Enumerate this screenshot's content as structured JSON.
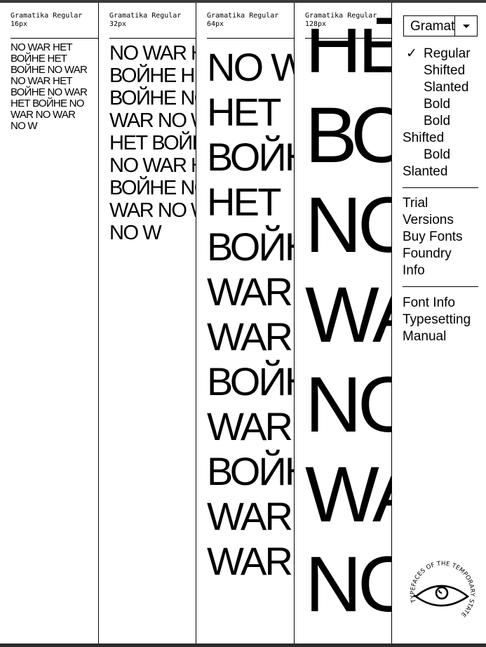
{
  "columns": [
    {
      "id": "c16",
      "header": "Gramatika Regular",
      "size": "16px",
      "lines": [
        "NO WAR НЕТ",
        "ВОЙНЕ НЕТ",
        "ВОЙНЕ NO WAR",
        "NO WAR НЕТ",
        "ВОЙНЕ NO WAR",
        "НЕТ ВОЙНЕ NO",
        "WAR NO WAR",
        "NO W"
      ]
    },
    {
      "id": "c32",
      "header": "Gramatika Regular",
      "size": "32px",
      "lines": [
        "NO WAR НЕТ",
        "ВОЙНЕ НЕТ",
        "ВОЙНЕ NO",
        "WAR NO WAR",
        "НЕТ ВОЙНЕ",
        "NO WAR НЕТ",
        "ВОЙНЕ NO",
        "WAR NO WAR",
        "NO W"
      ]
    },
    {
      "id": "c64",
      "header": "Gramatika Regular",
      "size": "64px",
      "lines": [
        "NO WAR",
        "НЕТ",
        "ВОЙНЕ",
        "НЕТ",
        "ВОЙНЕ",
        "WAR",
        "WAR",
        "ВОЙНЕ",
        "WAR",
        "ВОЙНЕ",
        "WAR",
        "WAR"
      ]
    },
    {
      "id": "c128",
      "header": "Gramatika Regular",
      "size": "128px",
      "lines": [
        "НЕТ",
        "ВО",
        "NO",
        "WA",
        "NO",
        "WA",
        "NO"
      ]
    }
  ],
  "panel": {
    "select_value": "Gramatika",
    "check_mark": "✓",
    "styles": [
      {
        "label": "Regular",
        "selected": true,
        "indent": true
      },
      {
        "label": "Shifted",
        "selected": false,
        "indent": true
      },
      {
        "label": "Slanted",
        "selected": false,
        "indent": true
      },
      {
        "label": "Bold",
        "selected": false,
        "indent": true
      },
      {
        "label": "Bold",
        "selected": false,
        "indent": true
      },
      {
        "label": "Shifted",
        "selected": false,
        "indent": false
      },
      {
        "label": "Bold",
        "selected": false,
        "indent": true
      },
      {
        "label": "Slanted",
        "selected": false,
        "indent": false
      }
    ],
    "links_primary": [
      "Trial",
      "Versions",
      "Buy Fonts",
      "Foundry",
      "Info"
    ],
    "links_secondary": [
      "Font Info",
      "Typesetting",
      "Manual"
    ],
    "logo_text": "TYPEFACES OF THE TEMPORARY STATE"
  }
}
